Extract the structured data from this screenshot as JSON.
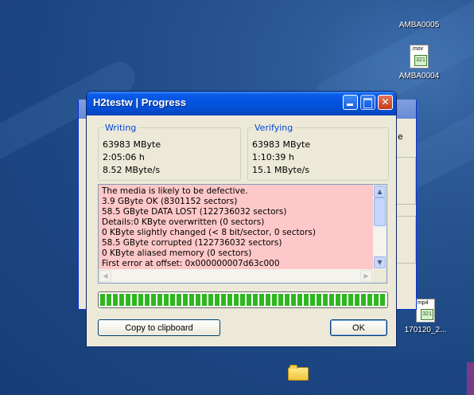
{
  "desktop": {
    "icons": [
      {
        "label": "AMBA0005",
        "ext": ""
      },
      {
        "label": "AMBA0004",
        "ext": ".mov"
      },
      {
        "label": "170120_2...",
        "ext": "mp4"
      }
    ]
  },
  "window": {
    "title": "H2testw | Progress",
    "writing": {
      "legend": "Writing",
      "size": "63983 MByte",
      "time": "2:05:06 h",
      "speed": "8.52 MByte/s"
    },
    "verifying": {
      "legend": "Verifying",
      "size": "63983 MByte",
      "time": "1:10:39 h",
      "speed": "15.1 MByte/s"
    },
    "log_lines": [
      "The media is likely to be defective.",
      "3.9 GByte OK (8301152 sectors)",
      "58.5 GByte DATA LOST (122736032 sectors)",
      "Details:0 KByte overwritten (0 sectors)",
      "0 KByte slightly changed (< 8 bit/sector, 0 sectors)",
      "58.5 GByte corrupted (122736032 sectors)",
      "0 KByte aliased memory (0 sectors)",
      "First error at offset: 0x000000007d63c000"
    ],
    "progress_fraction": 1.0,
    "copy_button": "Copy to clipboard",
    "ok_button": "OK"
  },
  "colors": {
    "log_background": "#ffc8c8",
    "progress_fill": "#2eb71e",
    "titlebar": "#0454e2"
  }
}
